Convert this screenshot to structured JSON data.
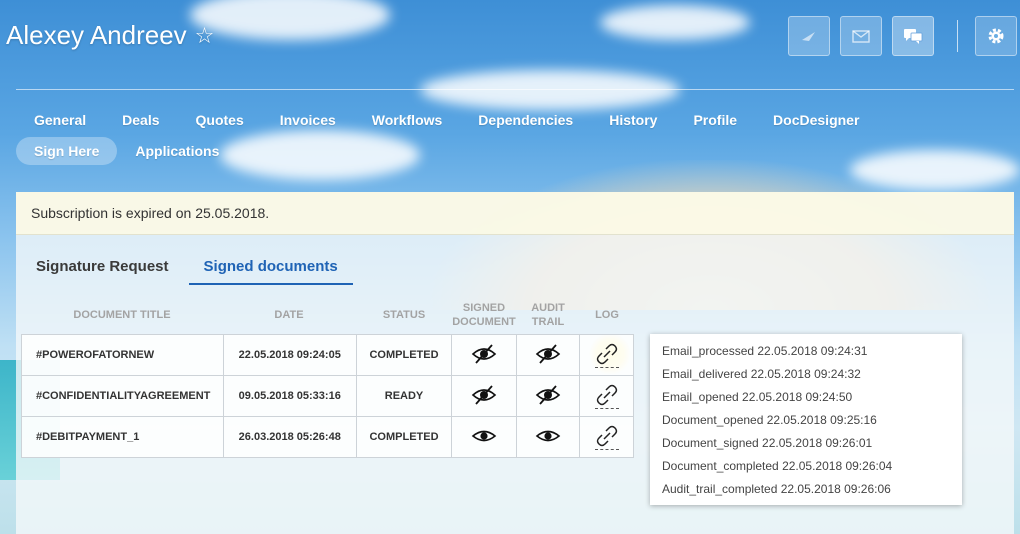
{
  "header": {
    "name": "Alexey Andreev",
    "star": "☆"
  },
  "nav": {
    "row1": [
      "General",
      "Deals",
      "Quotes",
      "Invoices",
      "Workflows",
      "Dependencies",
      "History",
      "Profile",
      "DocDesigner"
    ],
    "row2": [
      "Sign Here",
      "Applications"
    ],
    "active": "Sign Here"
  },
  "banner": "Subscription is expired on 25.05.2018.",
  "tabs": {
    "signature_request": "Signature Request",
    "signed_documents": "Signed documents"
  },
  "table": {
    "headers": {
      "title": "DOCUMENT TITLE",
      "date": "DATE",
      "status": "STATUS",
      "signed_1": "SIGNED",
      "signed_2": "DOCUMENT",
      "audit_1": "AUDIT",
      "audit_2": "TRAIL",
      "log": "LOG"
    },
    "rows": [
      {
        "title": "#POWEROFATORNEW",
        "date": "22.05.2018 09:24:05",
        "status": "COMPLETED",
        "signed_icon": "eye-off-icon",
        "audit_icon": "eye-off-icon",
        "log_icon": "link-icon"
      },
      {
        "title": "#CONFIDENTIALITYAGREEMENT",
        "date": "09.05.2018 05:33:16",
        "status": "READY",
        "signed_icon": "eye-off-icon",
        "audit_icon": "eye-off-icon",
        "log_icon": "link-icon"
      },
      {
        "title": "#DEBITPAYMENT_1",
        "date": "26.03.2018 05:26:48",
        "status": "COMPLETED",
        "signed_icon": "eye-icon",
        "audit_icon": "eye-icon",
        "log_icon": "link-icon"
      }
    ]
  },
  "log": [
    "Email_processed 22.05.2018 09:24:31",
    "Email_delivered 22.05.2018 09:24:32",
    "Email_opened 22.05.2018 09:24:50",
    "Document_opened 22.05.2018 09:25:16",
    "Document_signed 22.05.2018 09:26:01",
    "Document_completed 22.05.2018 09:26:04",
    "Audit_trail_completed 22.05.2018 09:26:06"
  ],
  "colors": {
    "accent": "#1f63b5",
    "highlight": "#ffec50"
  }
}
